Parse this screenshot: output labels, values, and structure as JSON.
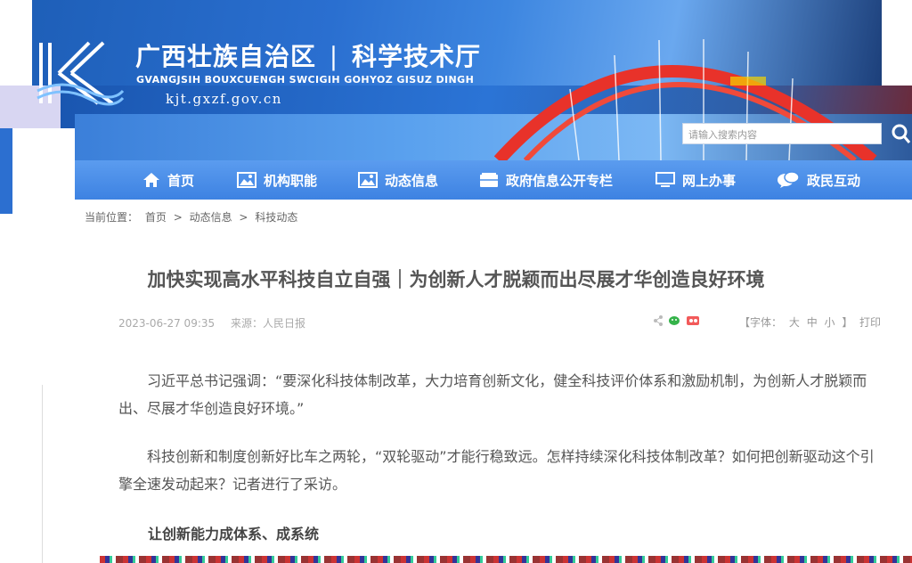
{
  "header": {
    "site_name_cn": "广西壮族自治区",
    "site_name_dept": "科学技术厅",
    "site_name_en": "GVANGJSIH BOUXCUENGH SWCIGIH GOHYOZ GISUZ DINGH",
    "url": "kjt.gxzf.gov.cn",
    "search_placeholder": "请输入搜索内容"
  },
  "nav": {
    "items": [
      {
        "label": "首页",
        "icon": "home-icon"
      },
      {
        "label": "机构职能",
        "icon": "picture-icon"
      },
      {
        "label": "动态信息",
        "icon": "picture-icon"
      },
      {
        "label": "政府信息公开专栏",
        "icon": "folder-icon"
      },
      {
        "label": "网上办事",
        "icon": "monitor-icon"
      },
      {
        "label": "政民互动",
        "icon": "chat-icon"
      }
    ]
  },
  "breadcrumb": {
    "prefix": "当前位置：",
    "items": [
      "首页",
      "动态信息",
      "科技动态"
    ],
    "separator": ">"
  },
  "article": {
    "title": "加快实现高水平科技自立自强｜为创新人才脱颖而出尽展才华创造良好环境",
    "date": "2023-06-27 09:35",
    "source": "来源：人民日报",
    "font_label": "【字体：",
    "font_sizes": [
      "大",
      "中",
      "小"
    ],
    "font_close": "】",
    "print": "打印",
    "paragraphs": [
      "习近平总书记强调：“要深化科技体制改革，大力培育创新文化，健全科技评价体系和激励机制，为创新人才脱颖而出、尽展才华创造良好环境。”",
      "科技创新和制度创新好比车之两轮，“双轮驱动”才能行稳致远。怎样持续深化科技体制改革？如何把创新驱动这个引擎全速发动起来？记者进行了采访。"
    ],
    "subheading": "让创新能力成体系、成系统"
  },
  "colors": {
    "nav_bg": "#4a8fe8",
    "banner_blue": "#2a6fd0",
    "bridge_red": "#e8322a"
  }
}
